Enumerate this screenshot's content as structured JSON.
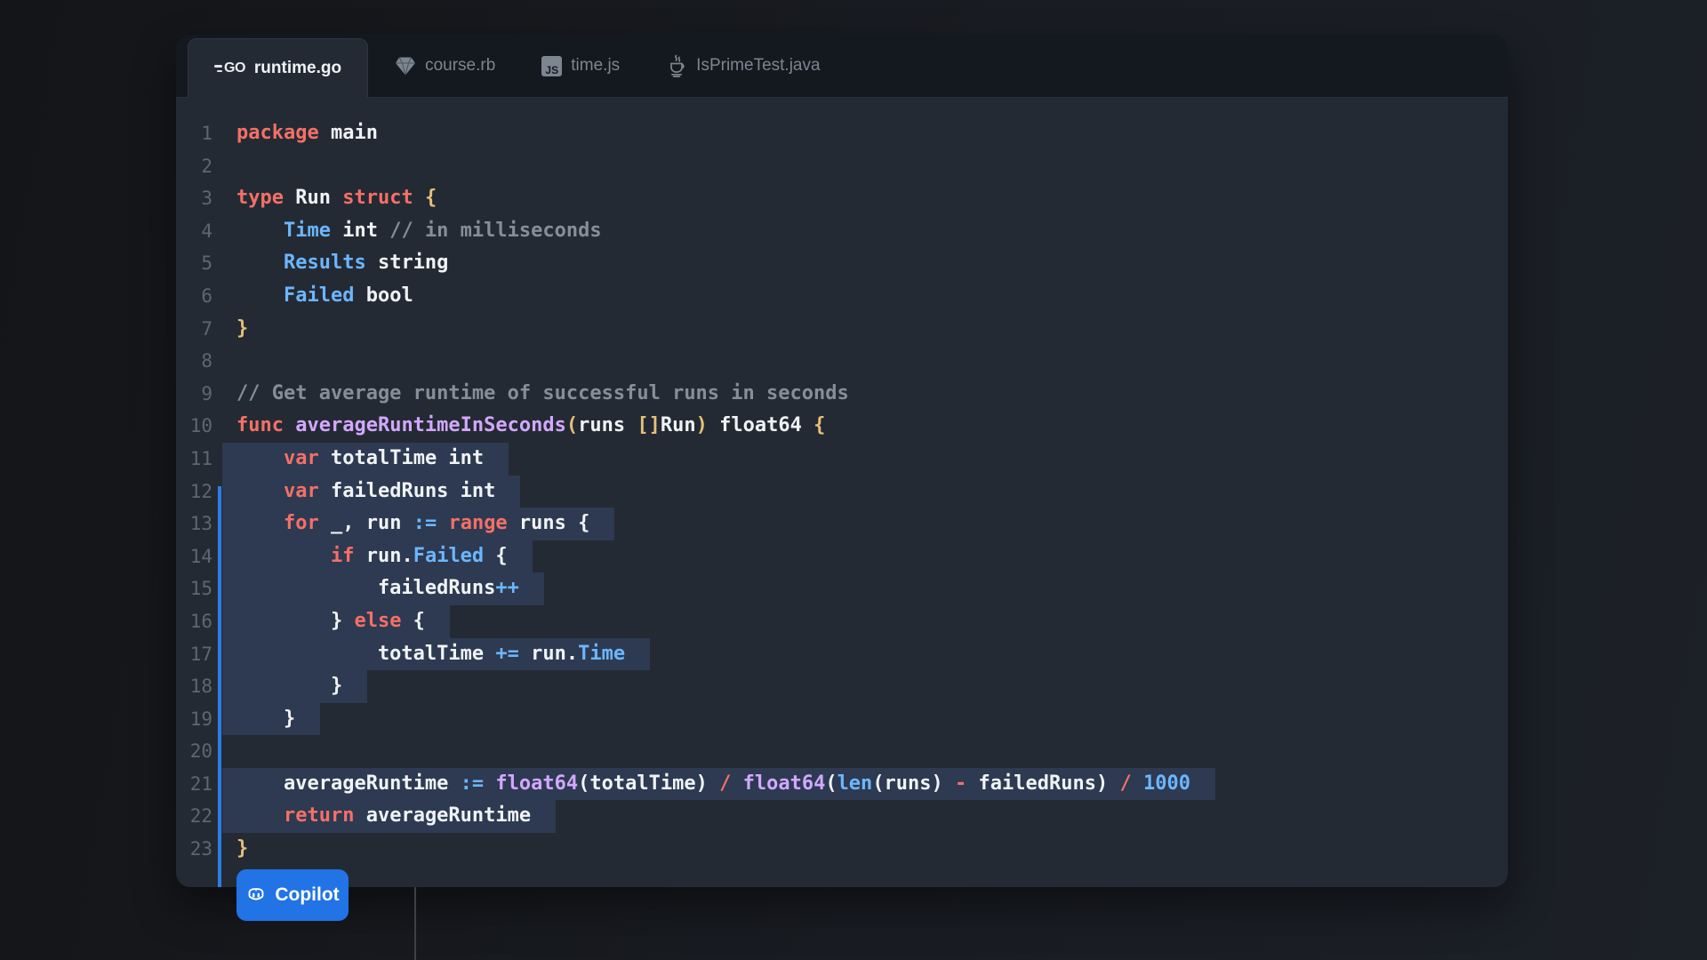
{
  "editor": {
    "tabs": [
      {
        "label": "runtime.go",
        "icon": "go",
        "active": true
      },
      {
        "label": "course.rb",
        "icon": "ruby",
        "active": false
      },
      {
        "label": "time.js",
        "icon": "js",
        "active": false
      },
      {
        "label": "IsPrimeTest.java",
        "icon": "java",
        "active": false
      }
    ],
    "js_icon_text": "JS",
    "go_icon_text": "GO",
    "code": {
      "language": "go",
      "lines": [
        {
          "n": 1,
          "hl": false,
          "tokens": [
            [
              "k",
              "package"
            ],
            [
              "w",
              " main"
            ]
          ]
        },
        {
          "n": 2,
          "hl": false,
          "tokens": []
        },
        {
          "n": 3,
          "hl": false,
          "tokens": [
            [
              "k",
              "type"
            ],
            [
              "w",
              " Run "
            ],
            [
              "k",
              "struct"
            ],
            [
              "w",
              " "
            ],
            [
              "y",
              "{"
            ]
          ]
        },
        {
          "n": 4,
          "hl": false,
          "tokens": [
            [
              "w",
              "    "
            ],
            [
              "b",
              "Time"
            ],
            [
              "w",
              " int "
            ],
            [
              "c",
              "// in milliseconds"
            ]
          ]
        },
        {
          "n": 5,
          "hl": false,
          "tokens": [
            [
              "w",
              "    "
            ],
            [
              "b",
              "Results"
            ],
            [
              "w",
              " string"
            ]
          ]
        },
        {
          "n": 6,
          "hl": false,
          "tokens": [
            [
              "w",
              "    "
            ],
            [
              "b",
              "Failed"
            ],
            [
              "w",
              " bool"
            ]
          ]
        },
        {
          "n": 7,
          "hl": false,
          "tokens": [
            [
              "y",
              "}"
            ]
          ]
        },
        {
          "n": 8,
          "hl": false,
          "tokens": []
        },
        {
          "n": 9,
          "hl": false,
          "tokens": [
            [
              "c",
              "// Get average runtime of successful runs in seconds"
            ]
          ]
        },
        {
          "n": 10,
          "hl": false,
          "tokens": [
            [
              "k",
              "func"
            ],
            [
              "w",
              " "
            ],
            [
              "p",
              "averageRuntimeInSeconds"
            ],
            [
              "y",
              "("
            ],
            [
              "w",
              "runs "
            ],
            [
              "y",
              "[]"
            ],
            [
              "w",
              "Run"
            ],
            [
              "y",
              ")"
            ],
            [
              "w",
              " float64 "
            ],
            [
              "y",
              "{"
            ]
          ]
        },
        {
          "n": 11,
          "hl": true,
          "tokens": [
            [
              "w",
              "    "
            ],
            [
              "k",
              "var"
            ],
            [
              "w",
              " totalTime int"
            ]
          ]
        },
        {
          "n": 12,
          "hl": true,
          "tokens": [
            [
              "w",
              "    "
            ],
            [
              "k",
              "var"
            ],
            [
              "w",
              " failedRuns int"
            ]
          ]
        },
        {
          "n": 13,
          "hl": true,
          "tokens": [
            [
              "w",
              "    "
            ],
            [
              "k",
              "for"
            ],
            [
              "w",
              " _, run "
            ],
            [
              "b",
              ":="
            ],
            [
              "w",
              " "
            ],
            [
              "k",
              "range"
            ],
            [
              "w",
              " runs {"
            ]
          ]
        },
        {
          "n": 14,
          "hl": true,
          "tokens": [
            [
              "w",
              "        "
            ],
            [
              "k",
              "if"
            ],
            [
              "w",
              " run."
            ],
            [
              "b",
              "Failed"
            ],
            [
              "w",
              " {"
            ]
          ]
        },
        {
          "n": 15,
          "hl": true,
          "tokens": [
            [
              "w",
              "            failedRuns"
            ],
            [
              "b",
              "++"
            ]
          ]
        },
        {
          "n": 16,
          "hl": true,
          "tokens": [
            [
              "w",
              "        } "
            ],
            [
              "k",
              "else"
            ],
            [
              "w",
              " {"
            ]
          ]
        },
        {
          "n": 17,
          "hl": true,
          "tokens": [
            [
              "w",
              "            totalTime "
            ],
            [
              "b",
              "+="
            ],
            [
              "w",
              " run."
            ],
            [
              "b",
              "Time"
            ]
          ]
        },
        {
          "n": 18,
          "hl": true,
          "tokens": [
            [
              "w",
              "        }"
            ]
          ]
        },
        {
          "n": 19,
          "hl": true,
          "tokens": [
            [
              "w",
              "    }"
            ]
          ]
        },
        {
          "n": 20,
          "hl": true,
          "hl_width": 91,
          "tokens": []
        },
        {
          "n": 21,
          "hl": true,
          "tokens": [
            [
              "w",
              "    averageRuntime "
            ],
            [
              "b",
              ":="
            ],
            [
              "w",
              " "
            ],
            [
              "p",
              "float64"
            ],
            [
              "w",
              "(totalTime) "
            ],
            [
              "k",
              "/"
            ],
            [
              "w",
              " "
            ],
            [
              "p",
              "float64"
            ],
            [
              "w",
              "("
            ],
            [
              "b",
              "len"
            ],
            [
              "w",
              "(runs) "
            ],
            [
              "k",
              "-"
            ],
            [
              "w",
              " failedRuns) "
            ],
            [
              "k",
              "/"
            ],
            [
              "w",
              " "
            ],
            [
              "b",
              "1000"
            ]
          ]
        },
        {
          "n": 22,
          "hl": true,
          "tokens": [
            [
              "w",
              "    "
            ],
            [
              "k",
              "return"
            ],
            [
              "w",
              " averageRuntime"
            ]
          ]
        },
        {
          "n": 23,
          "hl": false,
          "tokens": [
            [
              "y",
              "}"
            ]
          ]
        }
      ]
    }
  },
  "copilot_button": {
    "label": "Copilot"
  },
  "colors": {
    "accent_blue": "#2e7de5",
    "button_blue": "#2173e6",
    "highlight": "#2d3a51",
    "keyword": "#f47067",
    "type_blue": "#6cb6ff",
    "function_purple": "#d2a8ff",
    "comment_gray": "#858f99",
    "bracket_yellow": "#e5c07b"
  }
}
